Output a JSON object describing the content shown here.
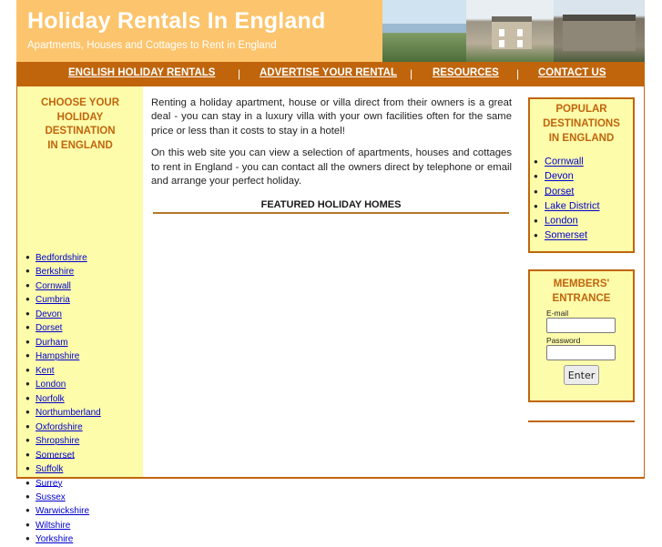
{
  "header": {
    "title": "Holiday Rentals In England",
    "tagline": "Apartments, Houses and Cottages to Rent in England"
  },
  "nav": {
    "items": [
      "ENGLISH HOLIDAY RENTALS",
      "ADVERTISE YOUR RENTAL",
      "RESOURCES",
      "CONTACT US"
    ],
    "separator": "|"
  },
  "sidebar": {
    "heading_lines": [
      "CHOOSE YOUR",
      "HOLIDAY",
      "DESTINATION",
      "IN ENGLAND"
    ],
    "counties": [
      "Bedfordshire",
      "Berkshire",
      "Cornwall",
      "Cumbria",
      "Devon",
      "Dorset",
      "Durham",
      "Hampshire",
      "Kent",
      "London",
      "Norfolk",
      "Northumberland",
      "Oxfordshire",
      "Shropshire",
      "Somerset",
      "Suffolk",
      "Surrey",
      "Sussex",
      "Warwickshire",
      "Wiltshire",
      "Yorkshire"
    ]
  },
  "main": {
    "paragraph_1": "Renting a holiday apartment, house or villa direct from their owners is a great deal - you can stay in a luxury villa with your own facilities often for the same price or less than it costs to stay in a hotel!",
    "paragraph_2": "On this web site you can view a selection of apartments, houses and cottages to rent in England - you can contact all the owners direct by telephone or email and arrange your perfect holiday.",
    "featured_heading": "FEATURED HOLIDAY HOMES"
  },
  "popular": {
    "heading_lines": [
      "POPULAR",
      "DESTINATIONS",
      "IN ENGLAND"
    ],
    "items": [
      "Cornwall",
      "Devon",
      "Dorset",
      "Lake District",
      "London",
      "Somerset"
    ]
  },
  "members": {
    "heading_lines": [
      "MEMBERS'",
      "ENTRANCE"
    ],
    "email_label": "E-mail",
    "email_value": "",
    "password_label": "Password",
    "password_value": "",
    "enter_label": "Enter"
  },
  "colors": {
    "header_bg": "#fcc46c",
    "nav_bg": "#c0650c",
    "sidebar_bg": "#fdfcab",
    "heading_orange": "#c0650c",
    "link_blue": "#0000cc"
  }
}
